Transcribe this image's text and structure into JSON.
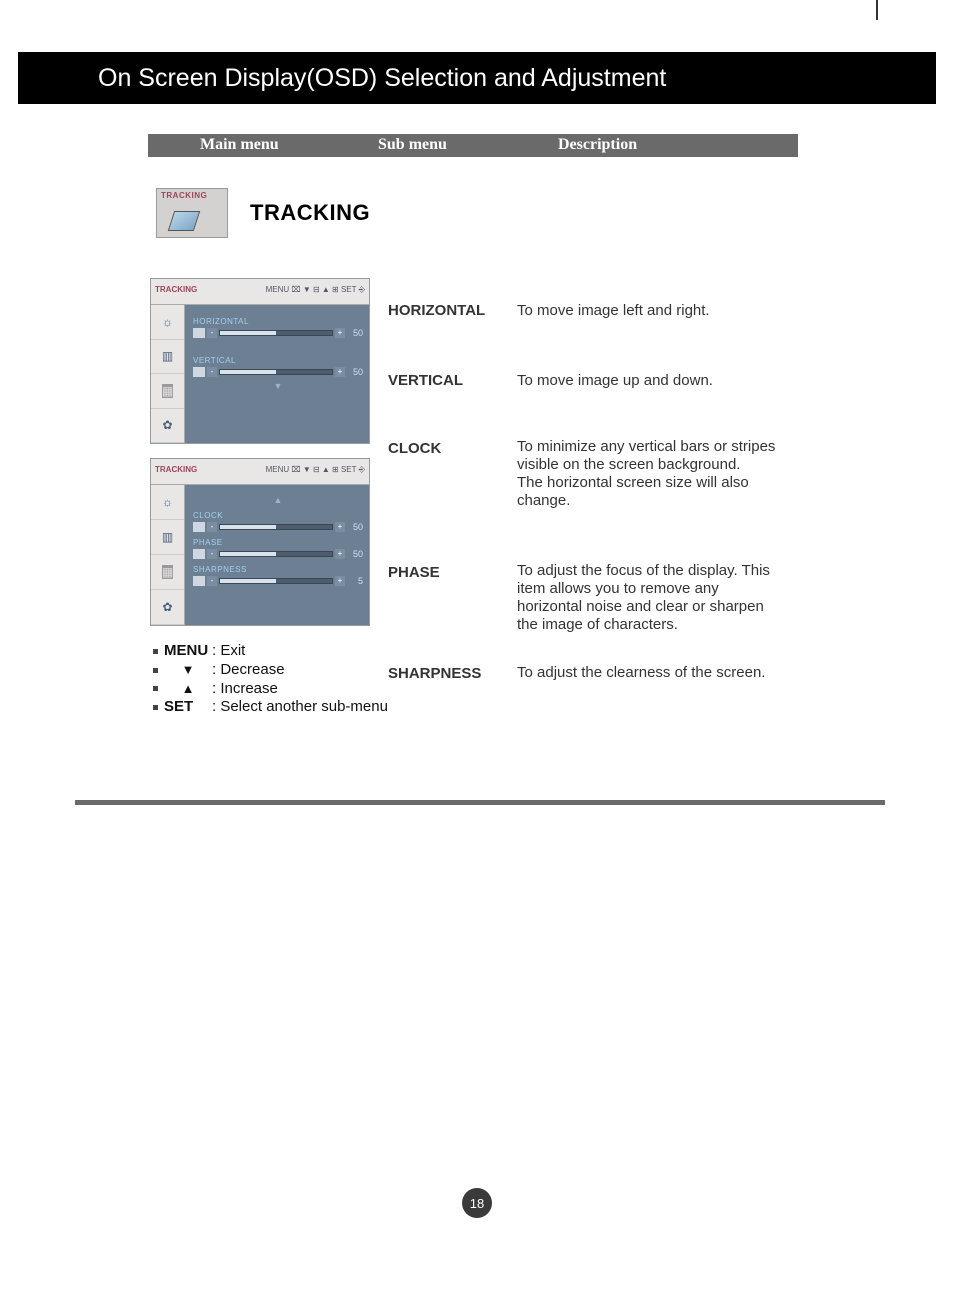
{
  "page_title": "On Screen Display(OSD) Selection and Adjustment",
  "columns": {
    "main": "Main menu",
    "sub": "Sub menu",
    "desc": "Description"
  },
  "tracking_icon_label": "TRACKING",
  "tracking_heading": "TRACKING",
  "osd_top": {
    "title": "TRACKING",
    "header_icons": "MENU ⌧  ▼ ⊟  ▲ ⊞  SET ⎆",
    "items": [
      {
        "name": "HORIZONTAL",
        "value": "50",
        "fill": "50%"
      },
      {
        "name": "VERTICAL",
        "value": "50",
        "fill": "50%"
      }
    ],
    "arrow": "▼"
  },
  "osd_bot": {
    "title": "TRACKING",
    "header_icons": "MENU ⌧  ▼ ⊟  ▲ ⊞  SET ⎆",
    "arrow": "▲",
    "items": [
      {
        "name": "CLOCK",
        "value": "50",
        "fill": "50%"
      },
      {
        "name": "PHASE",
        "value": "50",
        "fill": "50%"
      },
      {
        "name": "SHARPNESS",
        "value": "5",
        "fill": "50%"
      }
    ]
  },
  "submenus": {
    "horizontal": {
      "label": "HORIZONTAL",
      "desc": "To move image left and right."
    },
    "vertical": {
      "label": "VERTICAL",
      "desc": "To move image up and down."
    },
    "clock": {
      "label": "CLOCK",
      "desc": "To minimize any vertical bars or stripes visible on the screen background.\nThe horizontal screen size will also change."
    },
    "phase": {
      "label": "PHASE",
      "desc": "To adjust the focus of the display. This item allows you to remove any horizontal noise and clear or sharpen the image of characters."
    },
    "sharpness": {
      "label": "SHARPNESS",
      "desc": "To adjust the clearness of the screen."
    }
  },
  "legend": {
    "menu_key": "MENU",
    "menu_desc": ": Exit",
    "down_sym": "▼",
    "down_desc": ": Decrease",
    "up_sym": "▲",
    "up_desc": ": Increase",
    "set_key": "SET",
    "set_desc": ": Select another sub-menu"
  },
  "page_number": "18"
}
